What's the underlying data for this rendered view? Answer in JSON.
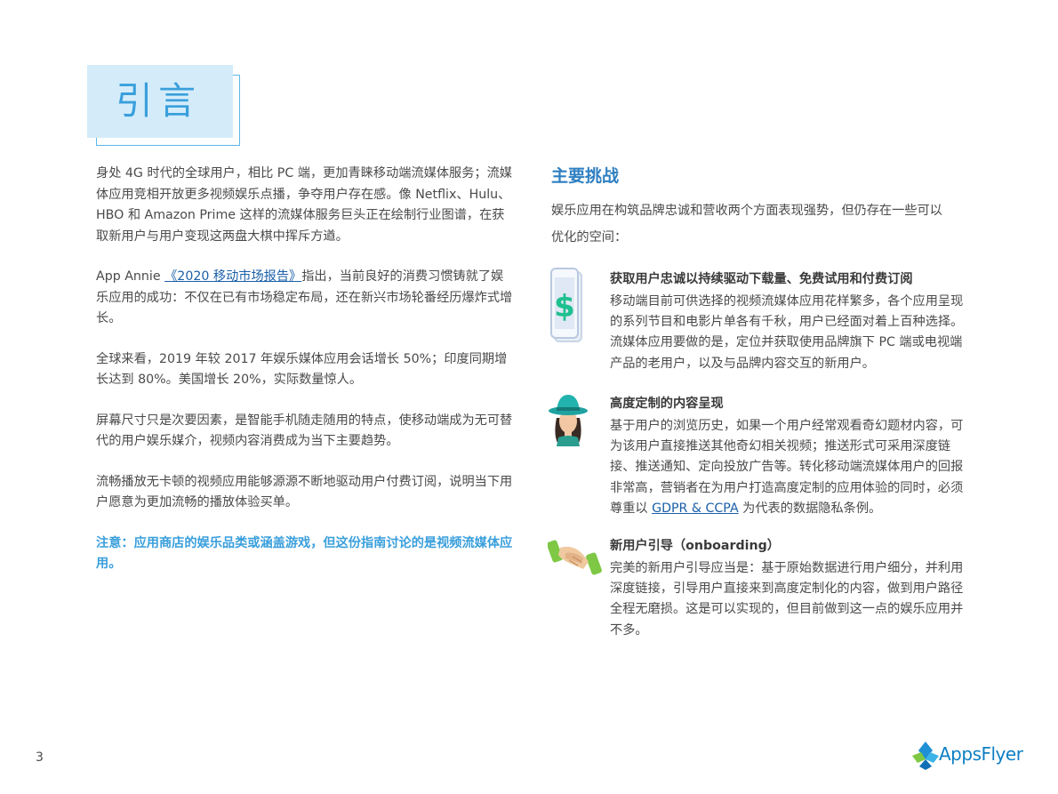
{
  "title": "引言",
  "left": {
    "p1": "身处 4G 时代的全球用户，相比 PC 端，更加青睐移动端流媒体服务；流媒体应用竞相开放更多视频娱乐点播，争夺用户存在感。像 Netflix、Hulu、HBO 和 Amazon Prime 这样的流媒体服务巨头正在绘制行业图谱，在获取新用户与用户变现这两盘大棋中挥斥方遒。",
    "p2_pre": "App Annie ",
    "p2_link": "《2020 移动市场报告》",
    "p2_post": "指出，当前良好的消费习惯铸就了娱乐应用的成功：不仅在已有市场稳定布局，还在新兴市场轮番经历爆炸式增长。",
    "p3": "全球来看，2019 年较 2017 年娱乐媒体应用会话增长 50%；印度同期增长达到 80%。美国增长 20%，实际数量惊人。",
    "p4": "屏幕尺寸只是次要因素，是智能手机随走随用的特点，使移动端成为无可替代的用户娱乐媒介，视频内容消费成为当下主要趋势。",
    "p5": "流畅播放无卡顿的视频应用能够源源不断地驱动用户付费订阅，说明当下用户愿意为更加流畅的播放体验买单。",
    "note": "注意：应用商店的娱乐品类或涵盖游戏，但这份指南讨论的是视频流媒体应用。"
  },
  "right": {
    "heading": "主要挑战",
    "intro": "娱乐应用在构筑品牌忠诚和营收两个方面表现强势，但仍存在一些可以优化的空间：",
    "items": [
      {
        "title": "获取用户忠诚以持续驱动下载量、免费试用和付费订阅",
        "body": "移动端目前可供选择的视频流媒体应用花样繁多，各个应用呈现的系列节目和电影片单各有千秋，用户已经面对着上百种选择。流媒体应用要做的是，定位并获取使用品牌旗下 PC 端或电视端产品的老用户，以及与品牌内容交互的新用户。",
        "icon": "phone-dollar-icon"
      },
      {
        "title": "高度定制的内容呈现",
        "body_pre": "基于用户的浏览历史，如果一个用户经常观看奇幻题材内容，可为该用户直接推送其他奇幻相关视频；推送形式可采用深度链接、推送通知、定向投放广告等。转化移动端流媒体用户的回报非常高，营销者在为用户打造高度定制的应用体验的同时，必须尊重以 ",
        "link": "GDPR & CCPA",
        "body_post": " 为代表的数据隐私条例。",
        "icon": "person-hat-icon"
      },
      {
        "title": "新用户引导（onboarding）",
        "body": "完美的新用户引导应当是：基于原始数据进行用户细分，并利用深度链接，引导用户直接来到高度定制化的内容，做到用户路径全程无磨损。这是可以实现的，但目前做到这一点的娱乐应用并不多。",
        "icon": "handshake-icon"
      }
    ]
  },
  "footer": {
    "page_number": "3",
    "logo_text": "AppsFlyer"
  },
  "colors": {
    "accent": "#3a9fdc",
    "heading": "#2f7fc1",
    "link": "#1a5fa8",
    "title_bg": "#d4ecfa"
  }
}
